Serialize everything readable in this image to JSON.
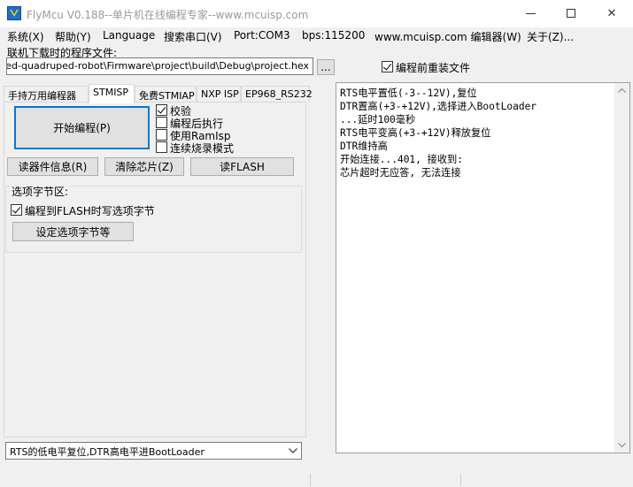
{
  "window": {
    "title": "FlyMcu V0.188--单片机在线编程专家--www.mcuisp.com",
    "icon": "flymcu-app-icon",
    "controls": {
      "minimize_icon": "minimize-icon",
      "maximize_icon": "maximize-icon",
      "close_icon": "close-icon",
      "close_glyph": "✕"
    }
  },
  "menu": {
    "items": [
      {
        "label": "系统(X)"
      },
      {
        "label": "帮助(Y)"
      },
      {
        "label": "Language"
      },
      {
        "label": "搜索串口(V)"
      },
      {
        "label": "Port:COM3"
      },
      {
        "label": "bps:115200"
      },
      {
        "label": "www.mcuisp.com 编辑器(W)"
      },
      {
        "label": "关于(Z)..."
      }
    ]
  },
  "file": {
    "label": "联机下载时的程序文件:",
    "path": "D:\\...\\-wheeled-quadruped-robot\\Firmware\\project\\build\\Debug\\project.hex",
    "browse_label": "...",
    "reload_label": "编程前重装文件",
    "reload_checked": true
  },
  "tabs": [
    {
      "label": "手持万用编程器",
      "active": false
    },
    {
      "label": "STMISP",
      "active": true
    },
    {
      "label": "免费STMIAP",
      "active": false
    },
    {
      "label": "NXP ISP",
      "active": false
    },
    {
      "label": "EP968_RS232",
      "active": false
    }
  ],
  "stmisp": {
    "start_button": "开始编程(P)",
    "options": [
      {
        "label": "校验",
        "checked": true
      },
      {
        "label": "编程后执行",
        "checked": false
      },
      {
        "label": "使用RamIsp",
        "checked": false
      },
      {
        "label": "连续烧录模式",
        "checked": false
      }
    ],
    "read_info_button": "读器件信息(R)",
    "erase_button": "清除芯片(Z)",
    "read_flash_button": "读FLASH",
    "option_group": {
      "legend": "选项字节区:",
      "write_option_label": "编程到FLASH时写选项字节",
      "write_option_checked": true,
      "set_option_button": "设定选项字节等"
    },
    "reset_mode": {
      "selected": "RTS的低电平复位,DTR高电平进BootLoader"
    }
  },
  "log": {
    "lines": [
      "RTS电平置低(-3--12V),复位",
      "DTR置高(+3-+12V),选择进入BootLoader",
      "...延时100毫秒",
      "RTS电平变高(+3-+12V)释放复位",
      "DTR维持高",
      "开始连接...401, 接收到:",
      "芯片超时无应答, 无法连接"
    ]
  }
}
